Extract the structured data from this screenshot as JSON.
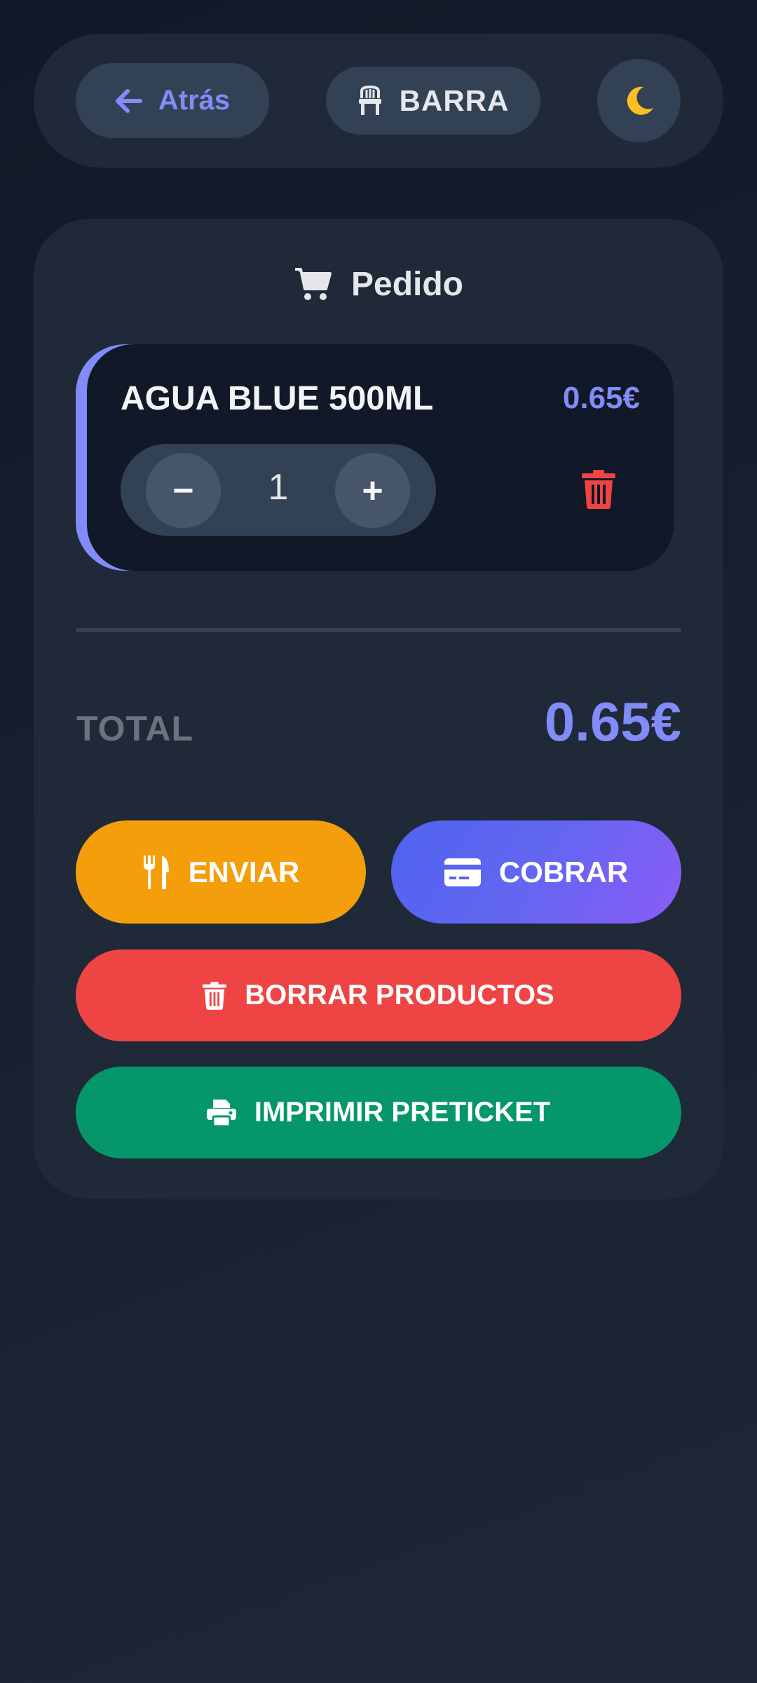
{
  "header": {
    "back_label": "Atrás",
    "table_label": "BARRA"
  },
  "order": {
    "title": "Pedido",
    "items": [
      {
        "name": "AGUA BLUE 500ML",
        "price": "0.65€",
        "quantity": "1",
        "minus": "−",
        "plus": "+"
      }
    ],
    "total_label": "TOTAL",
    "total_value": "0.65€"
  },
  "actions": {
    "send_label": "ENVIAR",
    "charge_label": "COBRAR",
    "clear_label": "BORRAR PRODUCTOS",
    "print_label": "IMPRIMIR PRETICKET"
  },
  "colors": {
    "accent": "#818cf8",
    "send": "#f59e0b",
    "charge": "#6366f1",
    "clear": "#ef4444",
    "print": "#059669",
    "moon": "#fbbf24"
  },
  "icons": {
    "back": "arrow-left-icon",
    "table": "chair-icon",
    "theme": "moon-icon",
    "order": "cart-icon",
    "delete": "trash-icon",
    "send": "utensils-icon",
    "charge": "credit-card-icon",
    "clear": "trash-icon",
    "print": "printer-icon"
  }
}
